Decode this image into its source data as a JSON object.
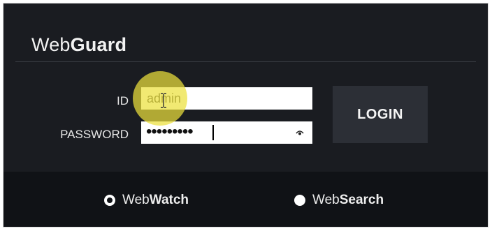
{
  "app": {
    "brand_prefix": "Web",
    "brand_suffix": "Guard"
  },
  "form": {
    "id_label": "ID",
    "id_value": "admin",
    "password_label": "PASSWORD",
    "password_value": "•••••••••",
    "login_label": "LOGIN"
  },
  "modes": [
    {
      "prefix": "Web",
      "suffix": "Watch",
      "selected": true
    },
    {
      "prefix": "Web",
      "suffix": "Search",
      "selected": false
    }
  ],
  "icons": {
    "password_toggle": "eye-icon",
    "text_cursor": "ibeam-cursor-icon"
  },
  "colors": {
    "panel_background": "#1a1c21",
    "footer_background": "#101216",
    "button_background": "#2c2f36",
    "cursor_highlight": "#ece03c"
  }
}
